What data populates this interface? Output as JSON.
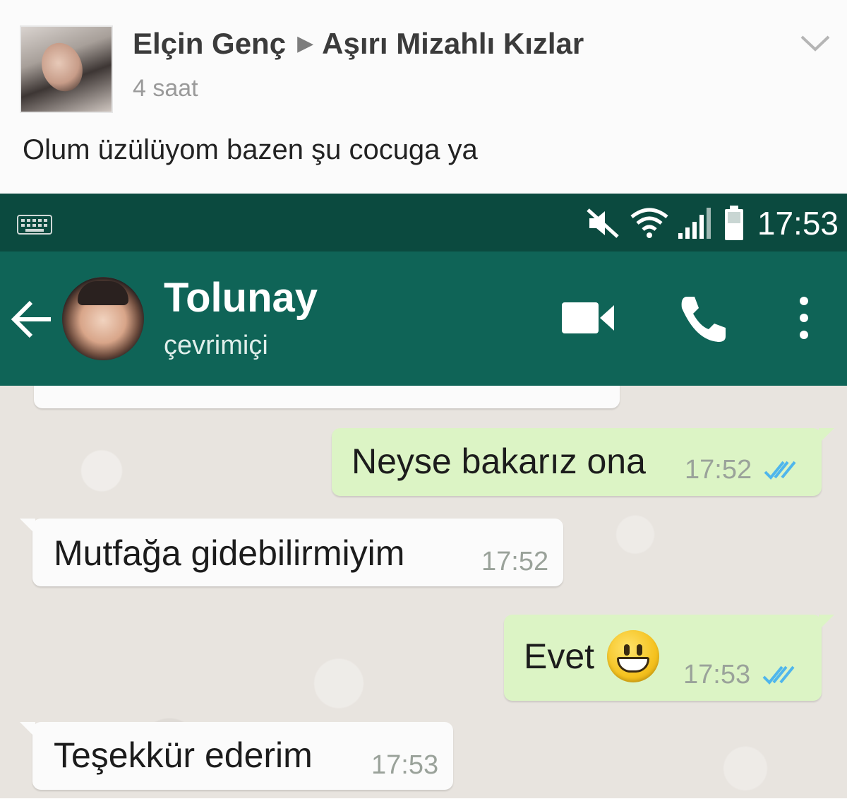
{
  "post": {
    "author": "Elçin Genç",
    "separator": "▶",
    "group": "Aşırı Mizahlı Kızlar",
    "time": "4 saat",
    "text": "Olum üzülüyom bazen şu cocuga ya",
    "menu_icon": "chevron-down-icon"
  },
  "status_bar": {
    "clock": "17:53",
    "icons": [
      "keyboard-icon",
      "mute-icon",
      "wifi-icon",
      "signal-icon",
      "battery-icon"
    ]
  },
  "header": {
    "contact_name": "Tolunay",
    "contact_status": "çevrimiçi",
    "icons": [
      "back-arrow-icon",
      "video-call-icon",
      "phone-icon",
      "more-options-icon"
    ],
    "bar_color": "#0f6457",
    "status_bar_color": "#0b4a3f"
  },
  "messages": [
    {
      "direction": "out",
      "text": "Neyse bakarız ona",
      "time": "17:52",
      "read": true
    },
    {
      "direction": "in",
      "text": "Mutfağa gidebilirmiyim",
      "time": "17:52"
    },
    {
      "direction": "out",
      "text": "Evet",
      "emoji": "grinning-face",
      "time": "17:53",
      "read": true
    },
    {
      "direction": "in",
      "text": "Teşekkür ederim",
      "time": "17:53"
    }
  ],
  "colors": {
    "outgoing_bubble": "#dcf4c5",
    "incoming_bubble": "#fbfbfb",
    "read_ticks": "#4fb6ec",
    "chat_background": "#e8e4df"
  }
}
